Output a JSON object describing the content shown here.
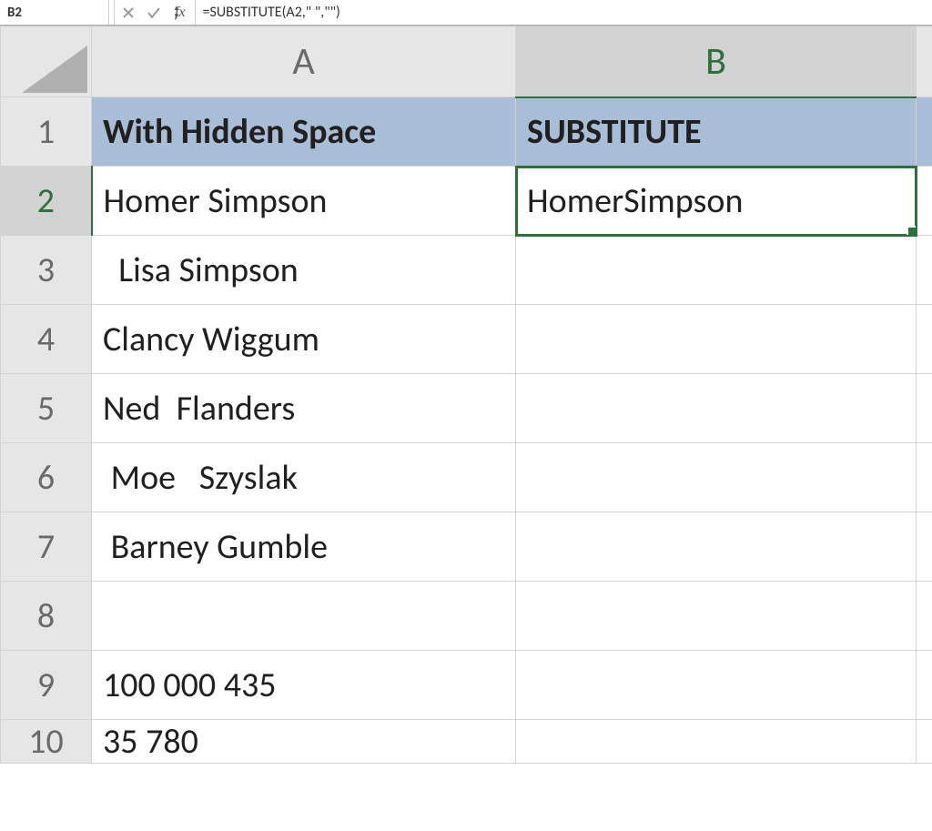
{
  "namebox": {
    "value": "B2"
  },
  "formula_bar": {
    "fx_label": "fx",
    "formula": "=SUBSTITUTE(A2,\" \",\"\")"
  },
  "columns": {
    "A": "A",
    "B": "B"
  },
  "selected_cell": "B2",
  "rows": [
    {
      "n": "1",
      "A": "With Hidden Space",
      "B": "SUBSTITUTE"
    },
    {
      "n": "2",
      "A": "Homer Simpson",
      "B": "HomerSimpson"
    },
    {
      "n": "3",
      "A": "  Lisa Simpson",
      "B": ""
    },
    {
      "n": "4",
      "A": "Clancy Wiggum",
      "B": ""
    },
    {
      "n": "5",
      "A": "Ned  Flanders",
      "B": ""
    },
    {
      "n": "6",
      "A": " Moe   Szyslak",
      "B": ""
    },
    {
      "n": "7",
      "A": " Barney Gumble",
      "B": ""
    },
    {
      "n": "8",
      "A": "",
      "B": ""
    },
    {
      "n": "9",
      "A": "100 000 435",
      "B": ""
    },
    {
      "n": "10",
      "A": "35 780",
      "B": ""
    }
  ]
}
